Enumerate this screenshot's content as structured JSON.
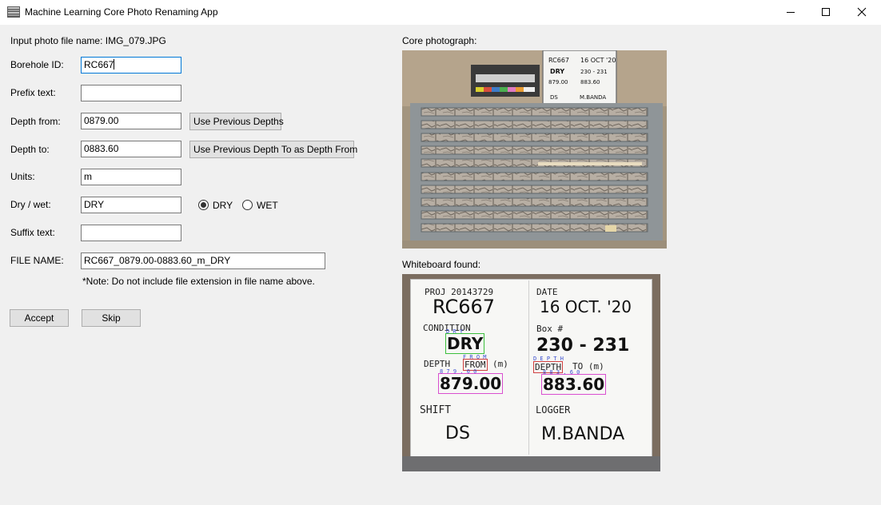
{
  "window": {
    "title": "Machine Learning Core Photo Renaming App",
    "icon": "app-grid-icon"
  },
  "form": {
    "input_photo_label": "Input photo file name: IMG_079.JPG",
    "borehole_label": "Borehole ID:",
    "borehole_value": "RC667",
    "prefix_label": "Prefix text:",
    "prefix_value": "",
    "depth_from_label": "Depth from:",
    "depth_from_value": "0879.00",
    "depth_to_label": "Depth to:",
    "depth_to_value": "0883.60",
    "units_label": "Units:",
    "units_value": "m",
    "drywet_label": "Dry / wet:",
    "drywet_value": "DRY",
    "suffix_label": "Suffix text:",
    "suffix_value": "",
    "filename_label": "FILE NAME:",
    "filename_value": "RC667_0879.00-0883.60_m_DRY",
    "note": "*Note: Do not include file extension in file name above."
  },
  "buttons": {
    "use_prev_depths": "Use Previous Depths",
    "use_prev_depth_to": "Use Previous Depth To as Depth From",
    "accept": "Accept",
    "skip": "Skip"
  },
  "radios": {
    "dry": "DRY",
    "wet": "WET",
    "selected": "DRY"
  },
  "images": {
    "core_label": "Core photograph:",
    "whiteboard_label": "Whiteboard found:"
  },
  "whiteboard": {
    "proj": "PROJ 20143729",
    "borehole": "RC667",
    "date_label": "DATE",
    "date": "16 OCT. '20",
    "condition_label": "CONDITION",
    "condition": "DRY",
    "box_label": "Box #",
    "box": "230 - 231",
    "depth_label": "DEPTH",
    "from_label": "FROM",
    "from_unit": "(m)",
    "from_value": "879.00",
    "depth2_label": "DEPTH",
    "to_label": "TO (m)",
    "to_value": "883.60",
    "shift_label": "SHIFT",
    "shift": "DS",
    "logger_label": "LOGGER",
    "logger": "M.BANDA",
    "det_dry": "D R Y",
    "det_from": "F R O M",
    "det_depth": "D E P T H",
    "det_from_digits": "8 7 9 . 0 0",
    "det_to_digits": "8 8 3 . 6 0"
  },
  "core_board": {
    "borehole": "RC667",
    "date": "16 OCT '20",
    "condition": "DRY",
    "box": "230 - 231",
    "from": "879.00",
    "to": "883.60",
    "shift": "DS",
    "logger": "M.BANDA"
  }
}
